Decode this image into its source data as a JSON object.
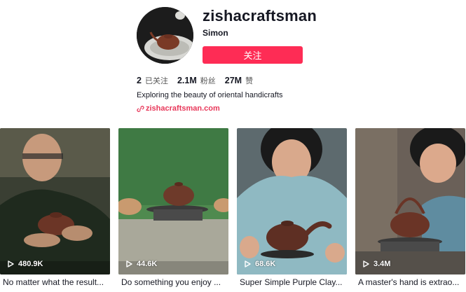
{
  "profile": {
    "username": "zishacraftsman",
    "nickname": "Simon",
    "follow_label": "关注",
    "stats": [
      {
        "value": "2",
        "label": "已关注"
      },
      {
        "value": "2.1M",
        "label": "粉丝"
      },
      {
        "value": "27M",
        "label": "赞"
      }
    ],
    "bio": "Exploring the beauty of oriental handicrafts",
    "link": "zishacraftsman.com"
  },
  "videos": [
    {
      "views": "480.9K",
      "caption": "No matter what the result..."
    },
    {
      "views": "44.6K",
      "caption": "Do something you enjoy ..."
    },
    {
      "views": "68.6K",
      "caption": "Super Simple Purple Clay..."
    },
    {
      "views": "3.4M",
      "caption": "A master's hand is extrao..."
    }
  ],
  "colors": {
    "accent": "#fe2c55",
    "link": "#e8385a"
  }
}
